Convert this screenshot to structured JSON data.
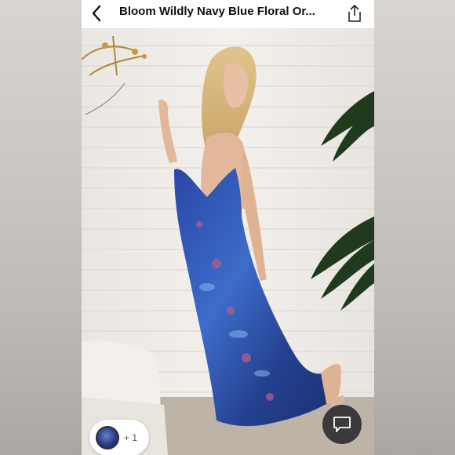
{
  "header": {
    "title": "Bloom Wildly Navy Blue Floral Or...",
    "back_icon": "chevron-left-icon",
    "share_icon": "share-icon"
  },
  "listing": {
    "image_description_icon": "product-photo",
    "dress_color": "#2f4fa8",
    "wall_color": "#f1eeea"
  },
  "gallery": {
    "more_photos_label": "+ 1"
  },
  "chat": {
    "icon": "message-icon"
  }
}
